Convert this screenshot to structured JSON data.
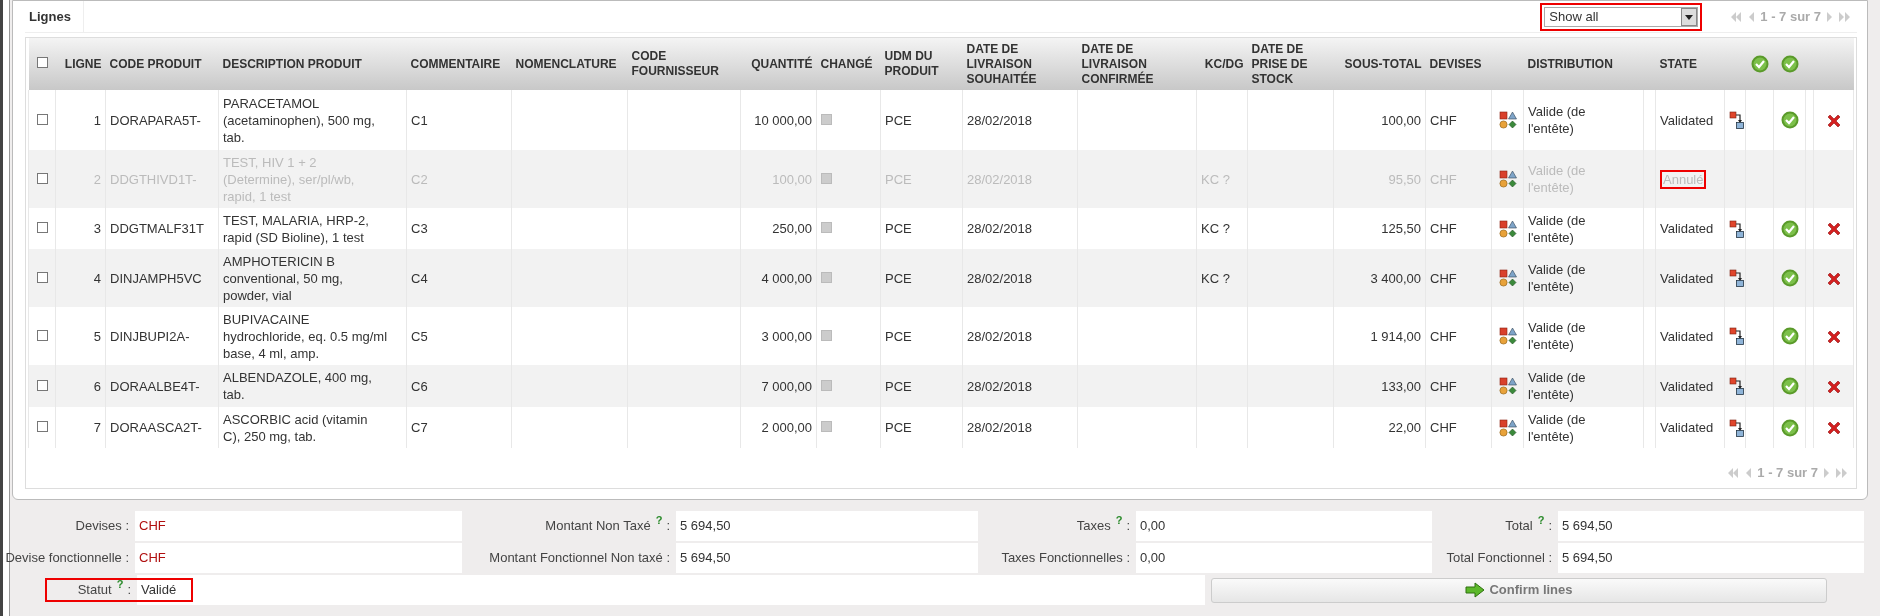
{
  "panel": {
    "title": "Lignes",
    "filter": {
      "value": "Show all",
      "highlighted": true
    },
    "pagination_top": "1 - 7 sur 7",
    "pagination_bottom": "1 - 7 sur 7"
  },
  "table": {
    "select_all": {
      "checked": false
    },
    "columns": [
      "LIGNE",
      "CODE PRODUIT",
      "DESCRIPTION PRODUIT",
      "COMMENTAIRE",
      "NOMENCLATURE",
      "CODE FOURNISSEUR",
      "QUANTITÉ",
      "CHANGÉ",
      "UDM DU PRODUIT",
      "DATE DE LIVRAISON SOUHAITÉE",
      "DATE DE LIVRAISON CONFIRMÉE",
      "KC/DG",
      "DATE DE PRISE DE STOCK",
      "SOUS-TOTAL",
      "DEVISES",
      "DISTRIBUTION",
      "STATE"
    ],
    "rows": [
      {
        "checked": false,
        "line": "1",
        "code": "DORAPARA5T-",
        "description": "PARACETAMOL (acetaminophen), 500 mg, tab.",
        "comment": "C1",
        "quantity": "10 000,00",
        "uom": "PCE",
        "date": "28/02/2018",
        "subtotal": "100,00",
        "currency": "CHF",
        "distribution": "Valide (de l'entête)",
        "state": "Validated",
        "cancelled": false
      },
      {
        "checked": false,
        "line": "2",
        "code": "DDGTHIVD1T-",
        "description": "TEST, HIV 1 + 2 (Determine), ser/pl/wb, rapid, 1 test",
        "comment": "C2",
        "quantity": "100,00",
        "uom": "PCE",
        "date": "28/02/2018",
        "kc_dg": "KC ?",
        "subtotal": "95,50",
        "currency": "CHF",
        "distribution": "Valide (de l'entête)",
        "state": "Annulé",
        "cancelled": true
      },
      {
        "checked": false,
        "line": "3",
        "code": "DDGTMALF31T",
        "description": "TEST, MALARIA, HRP-2, rapid (SD Bioline), 1 test",
        "comment": "C3",
        "quantity": "250,00",
        "uom": "PCE",
        "date": "28/02/2018",
        "kc_dg": "KC ?",
        "subtotal": "125,50",
        "currency": "CHF",
        "distribution": "Valide (de l'entête)",
        "state": "Validated",
        "cancelled": false
      },
      {
        "checked": false,
        "line": "4",
        "code": "DINJAMPH5VC",
        "description": "AMPHOTERICIN B conventional, 50 mg, powder, vial",
        "comment": "C4",
        "quantity": "4 000,00",
        "uom": "PCE",
        "date": "28/02/2018",
        "kc_dg": "KC ?",
        "subtotal": "3 400,00",
        "currency": "CHF",
        "distribution": "Valide (de l'entête)",
        "state": "Validated",
        "cancelled": false
      },
      {
        "checked": false,
        "line": "5",
        "code": "DINJBUPI2A-",
        "description": "BUPIVACAINE hydrochloride, eq. 0.5 mg/ml base, 4 ml, amp.",
        "comment": "C5",
        "quantity": "3 000,00",
        "uom": "PCE",
        "date": "28/02/2018",
        "subtotal": "1 914,00",
        "currency": "CHF",
        "distribution": "Valide (de l'entête)",
        "state": "Validated",
        "cancelled": false
      },
      {
        "checked": false,
        "line": "6",
        "code": "DORAALBE4T-",
        "description": "ALBENDAZOLE, 400 mg, tab.",
        "comment": "C6",
        "quantity": "7 000,00",
        "uom": "PCE",
        "date": "28/02/2018",
        "subtotal": "133,00",
        "currency": "CHF",
        "distribution": "Valide (de l'entête)",
        "state": "Validated",
        "cancelled": false
      },
      {
        "checked": false,
        "line": "7",
        "code": "DORAASCA2T-",
        "description": "ASCORBIC acid (vitamin C), 250 mg, tab.",
        "comment": "C7",
        "quantity": "2 000,00",
        "uom": "PCE",
        "date": "28/02/2018",
        "subtotal": "22,00",
        "currency": "CHF",
        "distribution": "Valide (de l'entête)",
        "state": "Validated",
        "cancelled": false
      }
    ]
  },
  "summary": [
    [
      {
        "label": "Devises :",
        "value": "CHF",
        "kind": "currency"
      },
      {
        "label": "Montant Non Taxé",
        "help": "?",
        "colon": ":",
        "value": "5 694,50",
        "kind": "amount"
      },
      {
        "label": "Taxes",
        "help": "?",
        "colon": ":",
        "value": "0,00",
        "kind": "amount"
      },
      {
        "label": "Total",
        "help": "?",
        "colon": ":",
        "value": "5 694,50",
        "kind": "amount"
      }
    ],
    [
      {
        "label": "Devise fonctionnelle :",
        "value": "CHF",
        "kind": "currency"
      },
      {
        "label": "Montant Fonctionnel Non taxé :",
        "value": "5 694,50",
        "kind": "amount"
      },
      {
        "label": "Taxes Fonctionnelles :",
        "value": "0,00",
        "kind": "amount"
      },
      {
        "label": "Total Fonctionnel :",
        "value": "5 694,50",
        "kind": "amount"
      }
    ]
  ],
  "status": {
    "label": "Statut",
    "help": "?",
    "colon": ":",
    "value": "Validé",
    "highlighted": true
  },
  "confirm_button": "Confirm lines"
}
